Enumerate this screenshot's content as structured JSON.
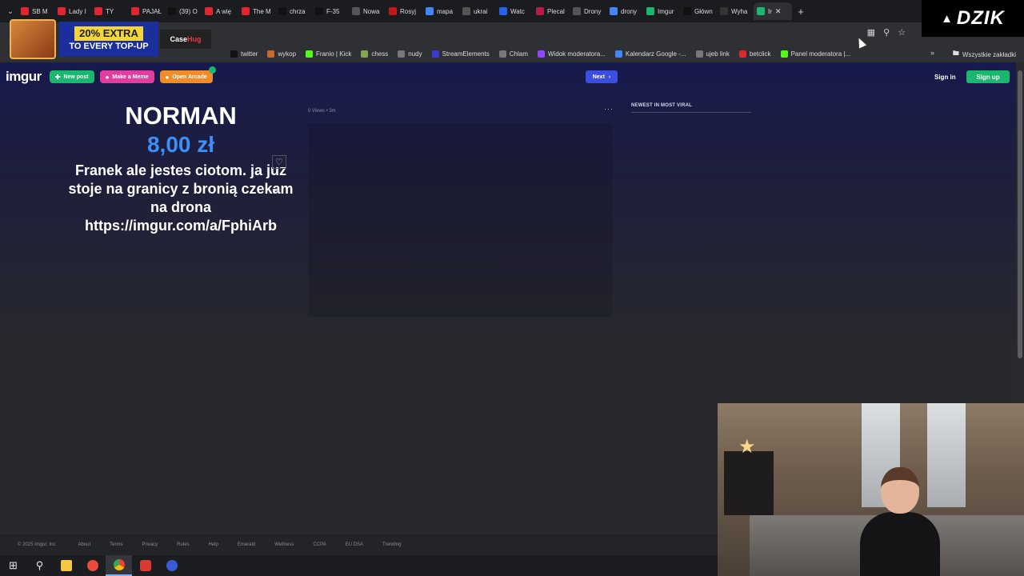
{
  "browser": {
    "tabs": [
      {
        "label": "SB M",
        "color": "#e0262e",
        "icon": "youtube-icon"
      },
      {
        "label": "Lady I",
        "color": "#e0262e",
        "icon": "youtube-icon"
      },
      {
        "label": "TY",
        "color": "#e0262e",
        "icon": "youtube-icon"
      },
      {
        "label": "PAJAŁ",
        "color": "#e0262e",
        "icon": "youtube-icon"
      },
      {
        "label": "(39) O",
        "color": "#111111",
        "icon": "tiktok-icon"
      },
      {
        "label": "A wię",
        "color": "#e0262e",
        "icon": "youtube-icon"
      },
      {
        "label": "The M",
        "color": "#e0262e",
        "icon": "youtube-icon"
      },
      {
        "label": "chrza",
        "color": "#111111",
        "icon": "x-icon"
      },
      {
        "label": "F-35",
        "color": "#111111",
        "icon": "tiktok-icon"
      },
      {
        "label": "Nowa",
        "color": "#555555",
        "icon": "globe-icon"
      },
      {
        "label": "Rosyj",
        "color": "#c01818",
        "icon": "news-icon"
      },
      {
        "label": "mapa",
        "color": "#4285f4",
        "icon": "google-icon"
      },
      {
        "label": "ukrai",
        "color": "#555555",
        "icon": "globe-icon"
      },
      {
        "label": "Watc",
        "color": "#2563eb",
        "icon": "globe-icon"
      },
      {
        "label": "Plecal",
        "color": "#b51d4a",
        "icon": "shop-icon"
      },
      {
        "label": "Drony",
        "color": "#555555",
        "icon": "globe-icon"
      },
      {
        "label": "drony",
        "color": "#4285f4",
        "icon": "google-icon"
      },
      {
        "label": "Imgur",
        "color": "#1bb76e",
        "icon": "imgur-icon"
      },
      {
        "label": "Główn",
        "color": "#111111",
        "icon": "x-icon"
      },
      {
        "label": "Wyha",
        "color": "#333333",
        "icon": "site-icon"
      },
      {
        "label": "Ir",
        "color": "#1bb76e",
        "icon": "imgur-icon",
        "active": true
      }
    ],
    "bookmarks": [
      {
        "label": "twitter",
        "color": "#111111"
      },
      {
        "label": "wykop",
        "color": "#c86a2b"
      },
      {
        "label": "Franio | Kick",
        "color": "#53fc18"
      },
      {
        "label": "chess",
        "color": "#7fa650"
      },
      {
        "label": "nudy",
        "color": "#777777"
      },
      {
        "label": "StreamElements",
        "color": "#3b3bd1"
      },
      {
        "label": "Chlam",
        "color": "#777777"
      },
      {
        "label": "Widok moderatora...",
        "color": "#9146ff"
      },
      {
        "label": "Kalendarz Google -...",
        "color": "#4285f4"
      },
      {
        "label": "ujeb link",
        "color": "#777777"
      },
      {
        "label": "betclick",
        "color": "#e0262e"
      },
      {
        "label": "Panel moderatora |...",
        "color": "#53fc18"
      }
    ],
    "all_bookmarks": "Wszystkie zakładki"
  },
  "ad": {
    "extra": "20% EXTRA",
    "topup": "TO EVERY TOP-UP",
    "brand_a": "Case",
    "brand_b": "Hug"
  },
  "stream_logo": "DZIK",
  "imgur": {
    "logo": "imgur",
    "new_post": "New post",
    "make_meme": "Make a Meme",
    "open_arcade": "Open Arcade",
    "next": "Next",
    "sign_in": "Sign in",
    "sign_up": "Sign up",
    "post_meta": "0 Views • 3m",
    "newest_heading": "NEWEST IN MOST VIRAL",
    "footer": [
      "© 2025 Imgur, Inc",
      "About",
      "Terms",
      "Privacy",
      "Rules",
      "Help",
      "Emerald",
      "Wellness",
      "CCPA",
      "EU DSA",
      "Trending"
    ]
  },
  "donation": {
    "name": "NORMAN",
    "amount": "8,00 zł",
    "message": "Franek ale jestes ciotom. ja juz stoje na granicy z bronią czekam na drona https://imgur.com/a/FphiArb"
  }
}
